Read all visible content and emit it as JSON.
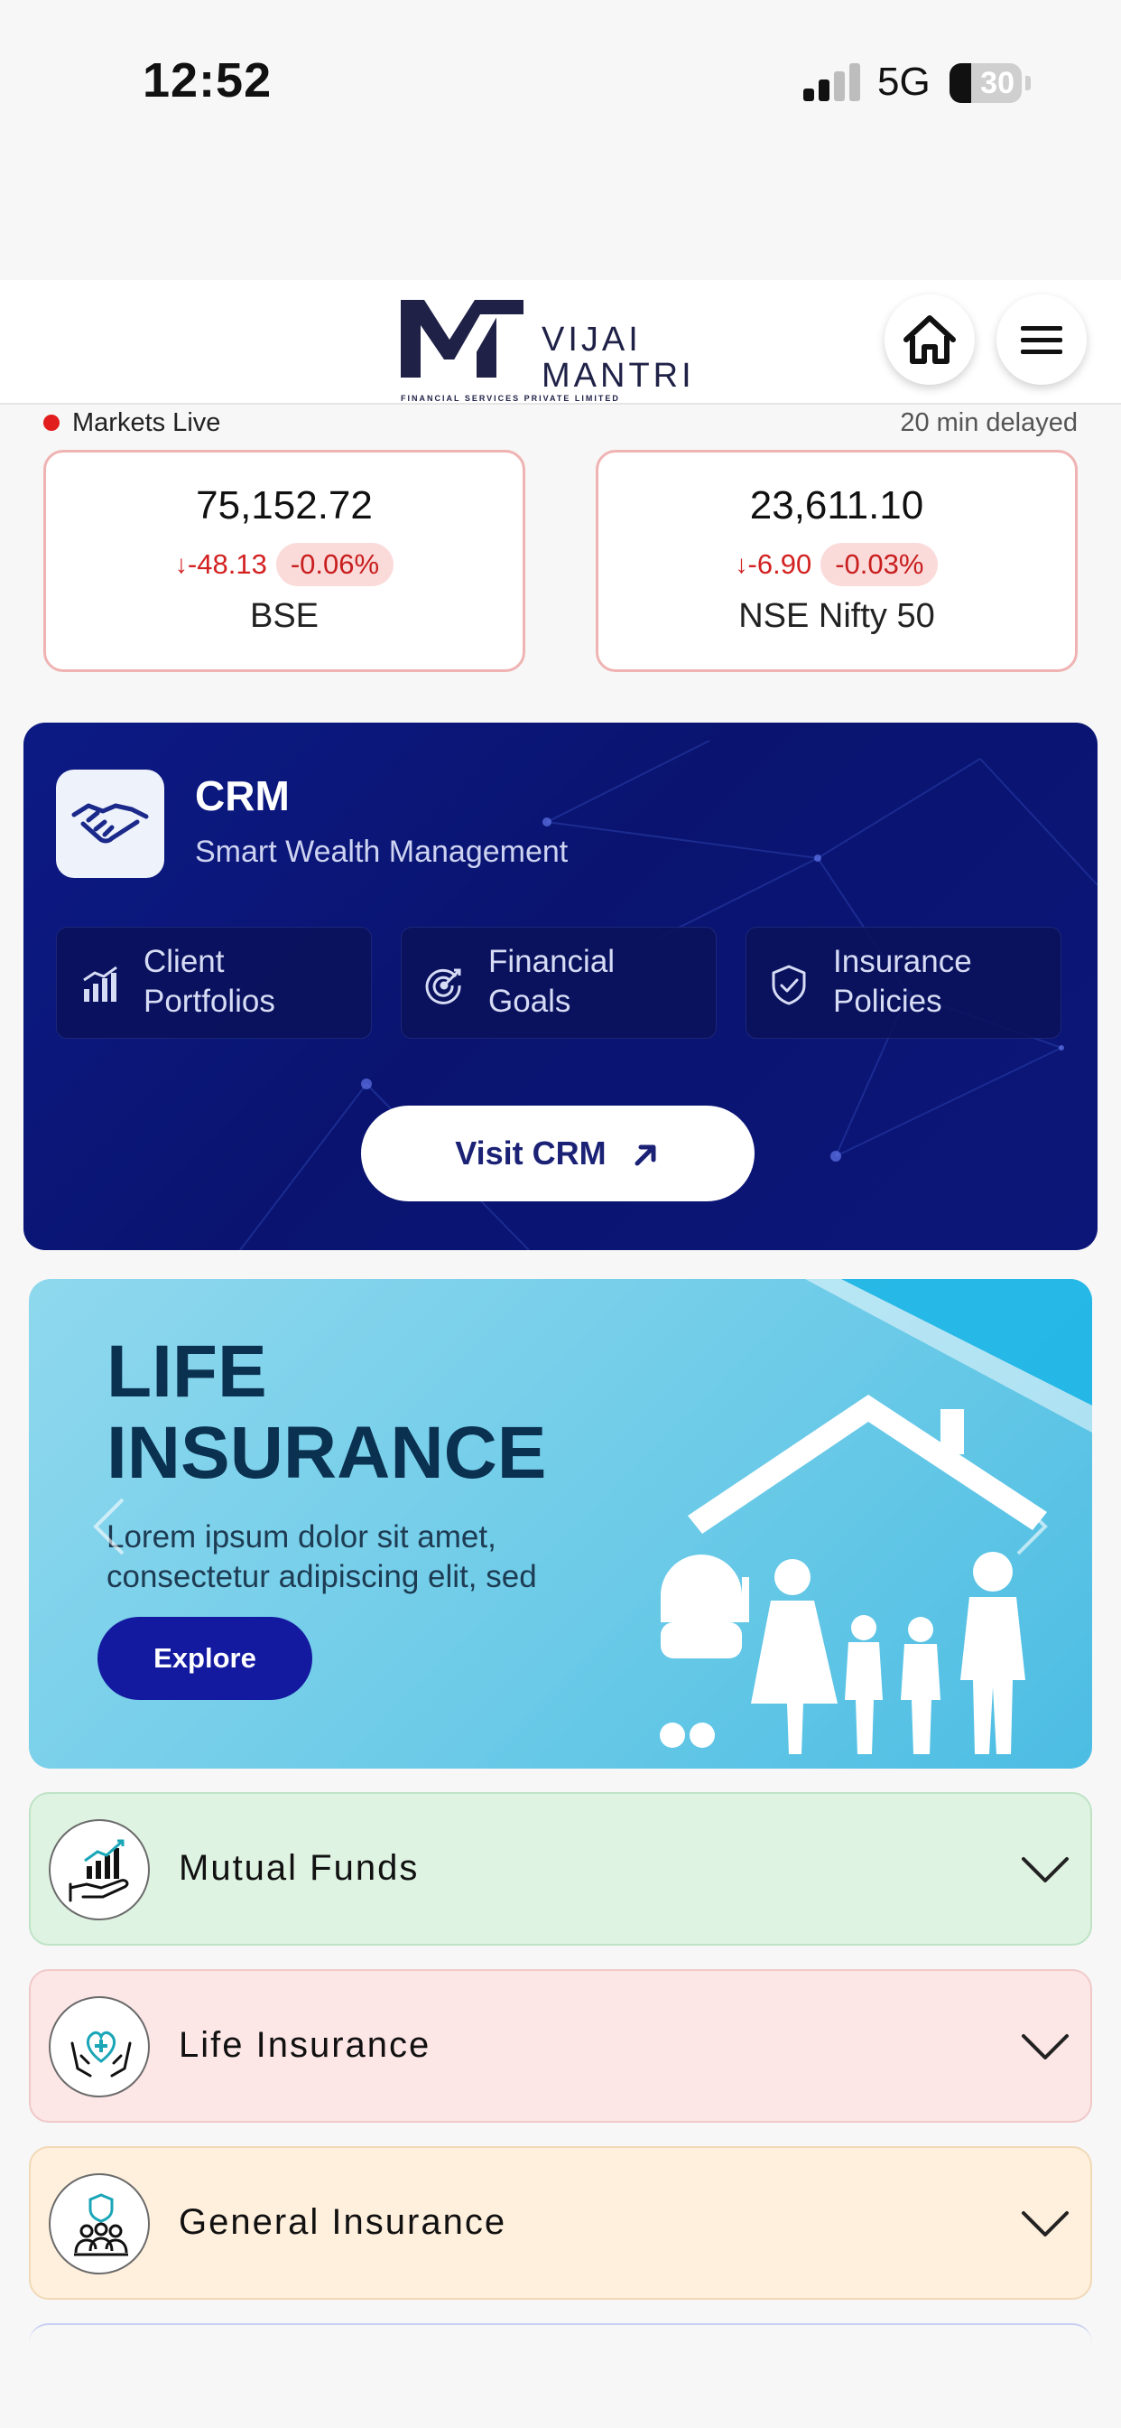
{
  "status_bar": {
    "time": "12:52",
    "network": "5G",
    "battery": "30",
    "battery_level": 0.3
  },
  "header": {
    "logo_line1": "VIJAI",
    "logo_line2": "MANTRI",
    "logo_tagline": "FINANCIAL SERVICES PRIVATE LIMITED",
    "home_icon": "home-icon",
    "menu_icon": "hamburger-menu-icon"
  },
  "markets": {
    "live_label": "Markets Live",
    "delay_label": "20 min delayed",
    "indices": [
      {
        "name": "BSE",
        "value": "75,152.72",
        "change": "-48.13",
        "percent": "-0.06%"
      },
      {
        "name": "NSE Nifty 50",
        "value": "23,611.10",
        "change": "-6.90",
        "percent": "-0.03%"
      }
    ],
    "down_color": "#d32222"
  },
  "crm": {
    "icon": "handshake-icon",
    "title": "CRM",
    "subtitle": "Smart Wealth Management",
    "features": [
      {
        "icon": "bar-chart-icon",
        "line1": "Client",
        "line2": "Portfolios"
      },
      {
        "icon": "target-icon",
        "line1": "Financial",
        "line2": "Goals"
      },
      {
        "icon": "shield-check-icon",
        "line1": "Insurance",
        "line2": "Policies"
      }
    ],
    "button_label": "Visit CRM",
    "button_icon": "arrow-up-right-icon"
  },
  "banner": {
    "title_line1": "LIFE",
    "title_line2": "INSURANCE",
    "text_line1": "Lorem ipsum dolor sit amet,",
    "text_line2": "consectetur adipiscing elit, sed",
    "button_label": "Explore"
  },
  "accordion": [
    {
      "label": "Mutual Funds",
      "icon": "investment-growth-icon",
      "color": "#dff3e2"
    },
    {
      "label": "Life Insurance",
      "icon": "family-protection-icon",
      "color": "#fde6e6"
    },
    {
      "label": "General Insurance",
      "icon": "group-shield-icon",
      "color": "#fff0dd"
    }
  ]
}
